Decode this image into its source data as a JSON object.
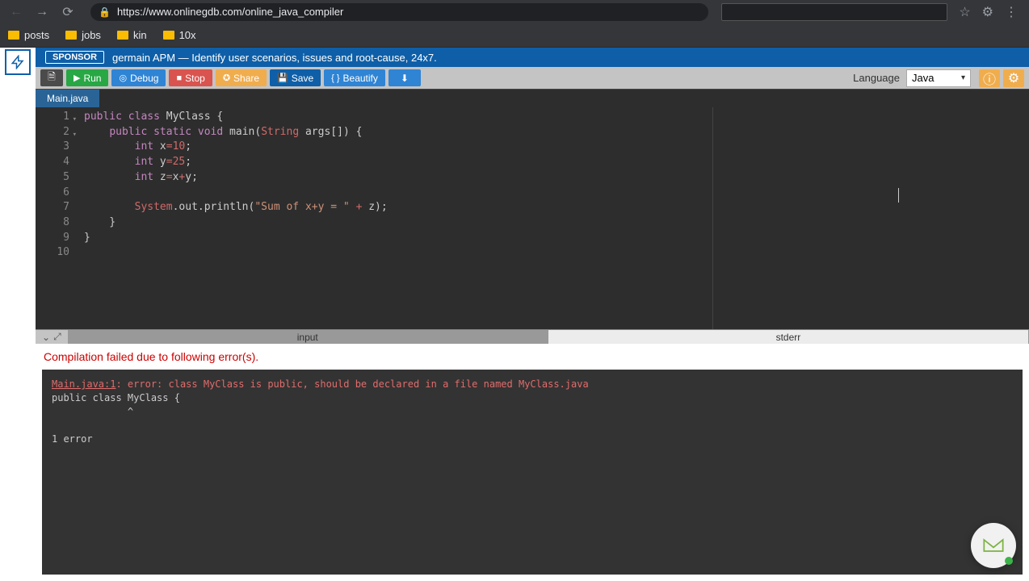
{
  "browser": {
    "url": "https://www.onlinegdb.com/online_java_compiler"
  },
  "bookmarks": [
    "posts",
    "jobs",
    "kin",
    "10x"
  ],
  "sponsor": {
    "badge": "SPONSOR",
    "text": "germain APM — Identify user scenarios, issues and root-cause, 24x7."
  },
  "toolbar": {
    "run": "Run",
    "debug": "Debug",
    "stop": "Stop",
    "share": "Share",
    "save": "Save",
    "beautify": "Beautify",
    "language_label": "Language",
    "language_value": "Java"
  },
  "tabs": {
    "file": "Main.java"
  },
  "code": {
    "lines": [
      "public class MyClass {",
      "    public static void main(String args[]) {",
      "        int x=10;",
      "        int y=25;",
      "        int z=x+y;",
      "",
      "        System.out.println(\"Sum of x+y = \" + z);",
      "    }",
      "}",
      ""
    ]
  },
  "panel": {
    "input_tab": "input",
    "stderr_tab": "stderr"
  },
  "compilation": {
    "header": "Compilation failed due to following error(s).",
    "err_file": "Main.java:1",
    "err_msg": ": error: class MyClass is public, should be declared in a file named MyClass.java",
    "code_line": "public class MyClass {",
    "caret": "             ^",
    "summary": "1 error"
  }
}
